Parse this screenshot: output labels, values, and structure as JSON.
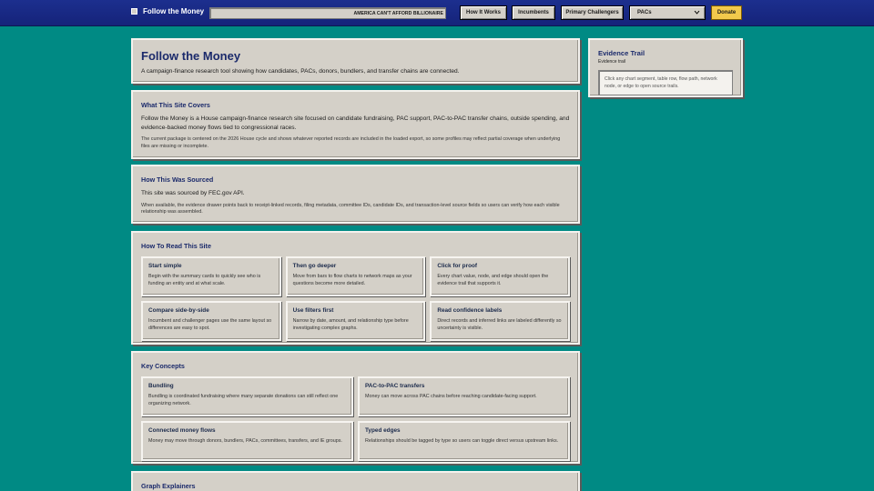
{
  "header": {
    "title": "Follow the Money",
    "ticker": "AMERICA CAN'T AFFORD BILLIONAIRE",
    "nav": [
      "How It Works",
      "Incumbents",
      "Primary Challengers"
    ],
    "select_value": "PACs",
    "donate": "Donate"
  },
  "hero": {
    "title": "Follow the Money",
    "subtitle": "A campaign-finance research tool showing how candidates, PACs, donors, bundlers, and transfer chains are connected."
  },
  "covers": {
    "title": "What This Site Covers",
    "body": "Follow the Money is a House campaign-finance research site focused on candidate fundraising, PAC support, PAC-to-PAC transfer chains, outside spending, and evidence-backed money flows tied to congressional races.",
    "note": "The current package is centered on the 2026 House cycle and shows whatever reported records are included in the loaded export, so some profiles may reflect partial coverage when underlying files are missing or incomplete."
  },
  "sourced": {
    "title": "How This Was Sourced",
    "body": "This site was sourced by FEC.gov API.",
    "note": "When available, the evidence drawer points back to receipt-linked records, filing metadata, committee IDs, candidate IDs, and transaction-level source fields so users can verify how each visible relationship was assembled."
  },
  "read": {
    "title": "How To Read This Site",
    "cards": [
      {
        "title": "Start simple",
        "text": "Begin with the summary cards to quickly see who is funding an entity and at what scale."
      },
      {
        "title": "Then go deeper",
        "text": "Move from bars to flow charts to network maps as your questions become more detailed."
      },
      {
        "title": "Click for proof",
        "text": "Every chart value, node, and edge should open the evidence trail that supports it."
      },
      {
        "title": "Compare side-by-side",
        "text": "Incumbent and challenger pages use the same layout so differences are easy to spot."
      },
      {
        "title": "Use filters first",
        "text": "Narrow by date, amount, and relationship type before investigating complex graphs."
      },
      {
        "title": "Read confidence labels",
        "text": "Direct records and inferred links are labeled differently so uncertainty is visible."
      }
    ]
  },
  "concepts": {
    "title": "Key Concepts",
    "cards": [
      {
        "title": "Bundling",
        "text": "Bundling is coordinated fundraising where many separate donations can still reflect one organizing network."
      },
      {
        "title": "PAC-to-PAC transfers",
        "text": "Money can move across PAC chains before reaching candidate-facing support."
      },
      {
        "title": "Connected money flows",
        "text": "Money may move through donors, bundlers, PACs, committees, transfers, and IE groups."
      },
      {
        "title": "Typed edges",
        "text": "Relationships should be tagged by type so users can toggle direct versus upstream links."
      }
    ]
  },
  "graphs": {
    "title": "Graph Explainers"
  },
  "evidence": {
    "title": "Evidence Trail",
    "subtitle": "Evidence trail",
    "placeholder": "Click any chart segment, table row, flow path, network node, or edge to open source trails."
  },
  "colors": {
    "background": "#008a84",
    "topbar": "#1c2f8e",
    "panel": "#d4d0c8",
    "heading": "#1b2a6b",
    "donate": "#f2c94c"
  }
}
